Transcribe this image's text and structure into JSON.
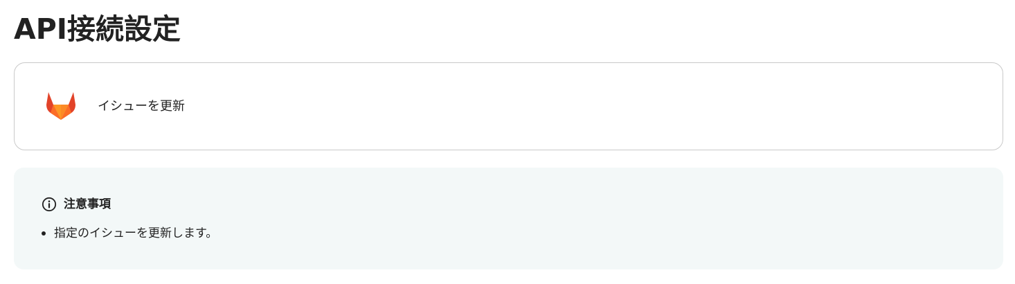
{
  "page": {
    "title": "API接続設定"
  },
  "action": {
    "icon": "gitlab-logo",
    "label": "イシューを更新"
  },
  "notice": {
    "icon": "info-icon",
    "title": "注意事項",
    "items": [
      "指定のイシューを更新します。"
    ]
  },
  "colors": {
    "text": "#222222",
    "card_border": "#c9c9c9",
    "notice_background": "#f3f8f8",
    "gitlab_dark": "#e24329",
    "gitlab_mid": "#fc6d26",
    "gitlab_light": "#fca326"
  }
}
